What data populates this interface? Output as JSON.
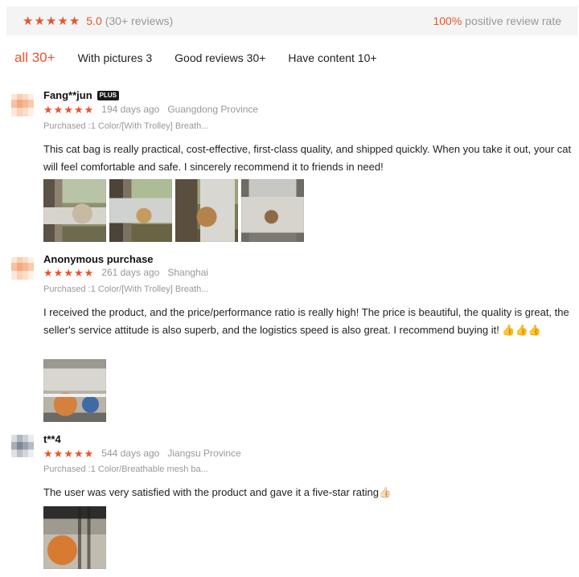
{
  "summary": {
    "stars": 5,
    "score": "5.0",
    "count": "(30+ reviews)",
    "positive_pct": "100%",
    "positive_label": "positive review rate",
    "accent_color": "#e8542b"
  },
  "tabs": [
    {
      "label": "all 30+",
      "active": true
    },
    {
      "label": "With pictures 3",
      "active": false
    },
    {
      "label": "Good reviews 30+",
      "active": false
    },
    {
      "label": "Have content 10+",
      "active": false
    }
  ],
  "reviews": [
    {
      "user": "Fang**jun",
      "badge": "PLUS",
      "stars": 5,
      "time": "194 days ago",
      "location": "Guangdong Province",
      "sku": "Purchased  :1 Color/[With Trolley] Breath...",
      "content": "This cat bag is really practical, cost-effective, first-class quality, and shipped quickly. When you take it out, your cat will feel comfortable and safe. I sincerely recommend it to friends in need!",
      "photos": 4
    },
    {
      "user": "Anonymous purchase",
      "stars": 5,
      "time": "261 days ago",
      "location": "Shanghai",
      "sku": "Purchased  :1 Color/[With Trolley] Breath...",
      "content": "I received the product, and the price/performance ratio is really high! The price is beautiful, the quality is great, the seller's service attitude is also superb, and the logistics speed is also great. I recommend buying it! 👍👍👍",
      "photos": 1
    },
    {
      "user": "t**4",
      "stars": 5,
      "time": "544 days ago",
      "location": "Jiangsu Province",
      "sku": "Purchased  :1 Color/Breathable mesh ba...",
      "content": "The user was very satisfied with the product and gave it a five-star rating👍🏻",
      "photos": 1
    }
  ]
}
